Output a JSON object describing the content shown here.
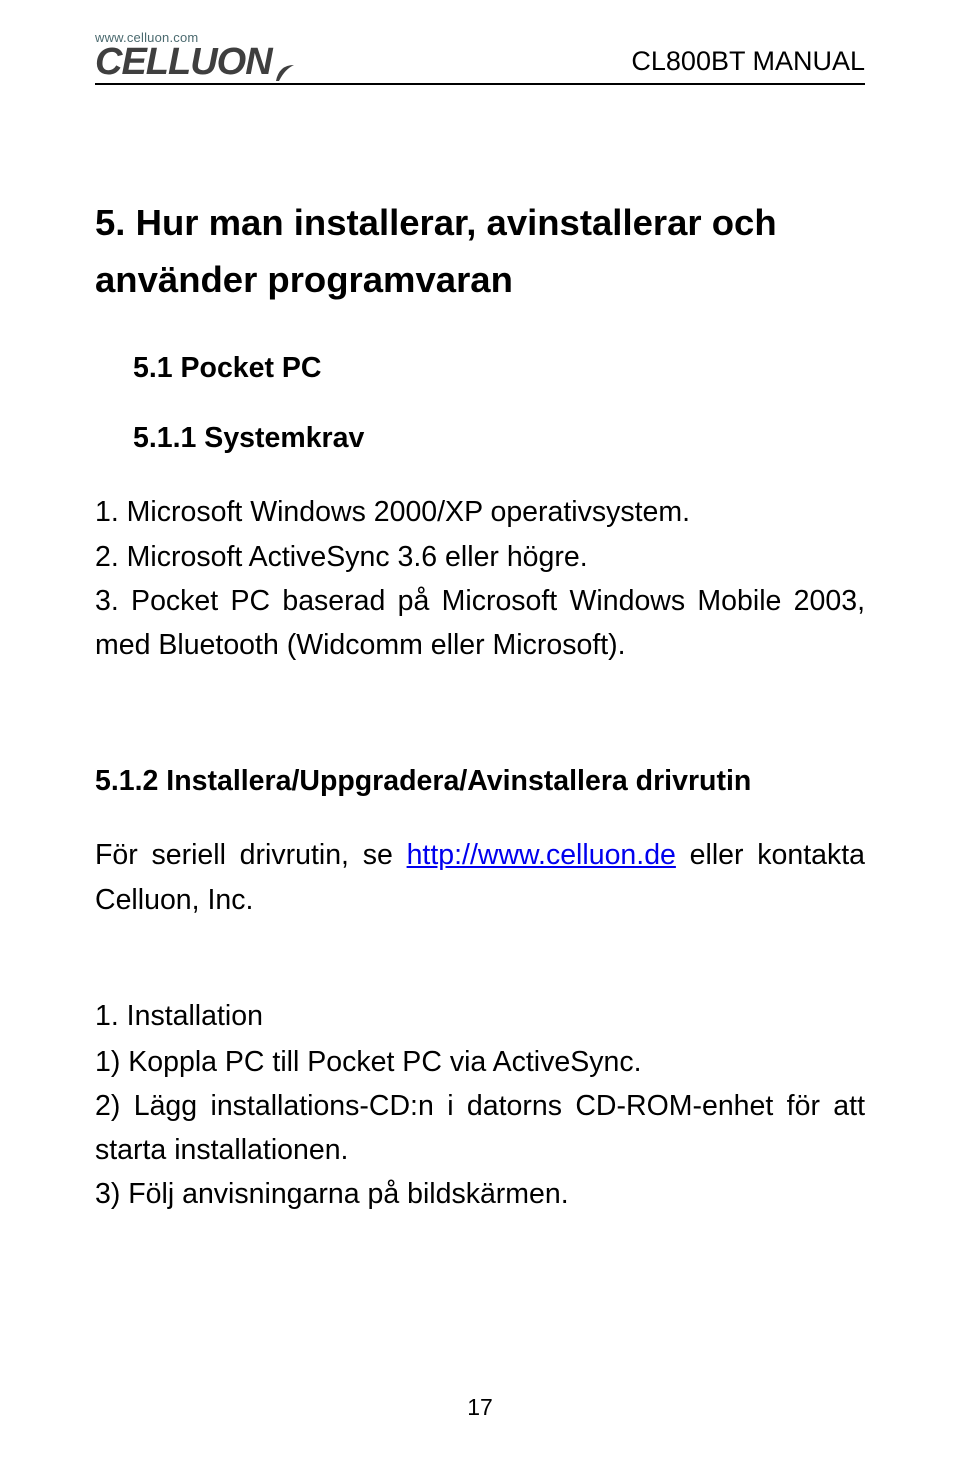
{
  "header": {
    "logo_url": "www.celluon.com",
    "logo_name": "CELLUON",
    "right": "CL800BT MANUAL"
  },
  "h1": "5. Hur man installerar, avinstallerar och använder programvaran",
  "h2_1": "5.1 Pocket PC",
  "h3_1": "5.1.1 Systemkrav",
  "list1": {
    "item1": "1. Microsoft Windows 2000/XP operativsystem.",
    "item2": "2. Microsoft ActiveSync 3.6 eller högre.",
    "item3": "3. Pocket PC baserad på Microsoft Windows Mobile 2003, med Bluetooth (Widcomm eller Microsoft)."
  },
  "h3_2": "5.1.2 Installera/Uppgradera/Avinstallera drivrutin",
  "p_serial_pre": "För seriell drivrutin, se ",
  "p_serial_link": "http://www.celluon.de",
  "p_serial_post": " eller kontakta Celluon, Inc.",
  "install_heading": "1. Installation",
  "install": {
    "s1": "1) Koppla PC till Pocket PC via ActiveSync.",
    "s2": "2) Lägg installations-CD:n i datorns CD-ROM-enhet för att starta installationen.",
    "s3": "3) Följ anvisningarna på bildskärmen."
  },
  "page_number": "17"
}
